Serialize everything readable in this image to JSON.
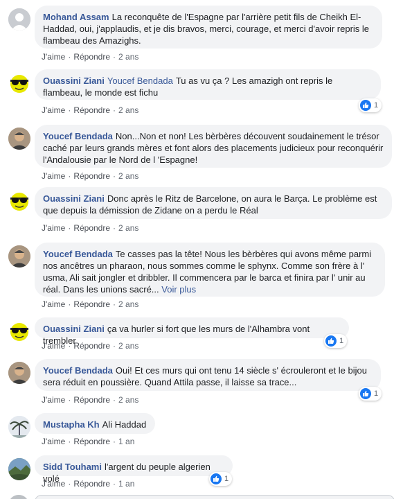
{
  "actions": {
    "like": "J'aime",
    "reply": "Répondre",
    "dot": "·"
  },
  "comments": [
    {
      "author": "Mohand Assam",
      "text": "La reconquête de l'Espagne par l'arrière petit fils de Cheikh El-Haddad, oui, j'applaudis, et je dis bravos, merci, courage, et merci d'avoir repris le flambeau des Amazighs.",
      "time": "2 ans",
      "avatar": "default-avatar-icon"
    },
    {
      "author": "Ouassini Ziani",
      "mention": "Youcef Bendada",
      "text": "Tu as vu ça ? Les amazigh ont repris le flambeau, le monde est fichu",
      "time": "2 ans",
      "avatar": "smiley-sunglasses-avatar",
      "reactions": "1"
    },
    {
      "author": "Youcef Bendada",
      "text": "Non...Non et non! Les bèrbères découvent soudainement le trésor caché par leurs grands mères et font alors des placements judicieux pour reconquérir l'Andalousie par le Nord de l 'Espagne!",
      "time": "2 ans",
      "avatar": "man-photo-avatar"
    },
    {
      "author": "Ouassini Ziani",
      "text": "Donc après le Ritz de Barcelone, on aura le Barça. Le problème est que depuis la démission de Zidane on a perdu le Réal",
      "time": "2 ans",
      "avatar": "smiley-sunglasses-avatar"
    },
    {
      "author": "Youcef Bendada",
      "text": "Te casses pas la tête! Nous les bèrbères qui avons même parmi nos ancêtres un pharaon, nous sommes comme le sphynx. Comme son frère à l' usma, Ali sait jongler et dribbler. Il commencera par le barca et finira par l' unir au réal. Dans les unions sacré...",
      "more": "Voir plus",
      "time": "2 ans",
      "avatar": "man-photo-avatar"
    },
    {
      "author": "Ouassini Ziani",
      "text": "ça va hurler si fort que les murs de l'Alhambra vont trembler",
      "time": "2 ans",
      "avatar": "smiley-sunglasses-avatar",
      "reactions": "1"
    },
    {
      "author": "Youcef Bendada",
      "text": "Oui! Et ces murs qui ont tenu 14 siècle s' écrouleront et le bijou sera réduit en poussière. Quand Attila passe, il laisse sa trace...",
      "time": "2 ans",
      "avatar": "man-photo-avatar",
      "reactions": "1"
    },
    {
      "author": "Mustapha Kh",
      "text": "Ali Haddad",
      "time": "1 an",
      "avatar": "palm-tree-avatar"
    },
    {
      "author": "Sidd Touhami",
      "text": "l'argent du peuple algerien volé",
      "time": "1 an",
      "avatar": "landscape-avatar",
      "reactions": "1"
    }
  ]
}
